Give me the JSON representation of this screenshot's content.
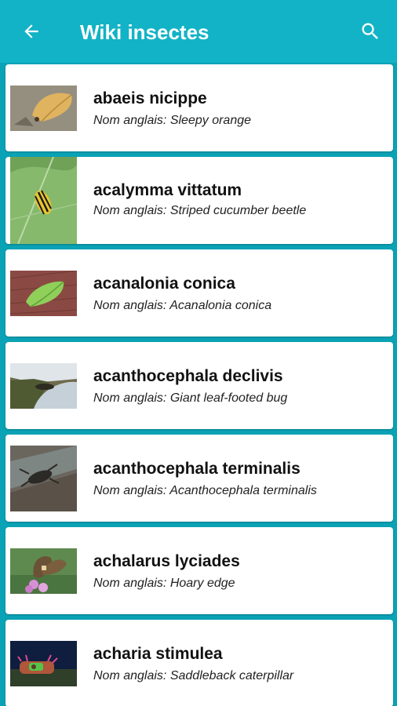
{
  "appbar": {
    "title": "Wiki insectes",
    "back_icon": "arrow-left-icon",
    "search_icon": "search-icon",
    "background_color": "#12b3c6"
  },
  "list": {
    "items": [
      {
        "name": "abaeis nicippe",
        "subtitle": "Nom anglais: Sleepy orange"
      },
      {
        "name": "acalymma vittatum",
        "subtitle": "Nom anglais: Striped cucumber beetle"
      },
      {
        "name": "acanalonia conica",
        "subtitle": "Nom anglais: Acanalonia conica"
      },
      {
        "name": "acanthocephala declivis",
        "subtitle": "Nom anglais: Giant leaf-footed bug"
      },
      {
        "name": "acanthocephala terminalis",
        "subtitle": "Nom anglais: Acanthocephala terminalis"
      },
      {
        "name": "achalarus lyciades",
        "subtitle": "Nom anglais: Hoary edge"
      },
      {
        "name": "acharia stimulea",
        "subtitle": "Nom anglais: Saddleback caterpillar"
      }
    ]
  },
  "colors": {
    "page_background": "#0aa3b6",
    "card_background": "#ffffff"
  }
}
